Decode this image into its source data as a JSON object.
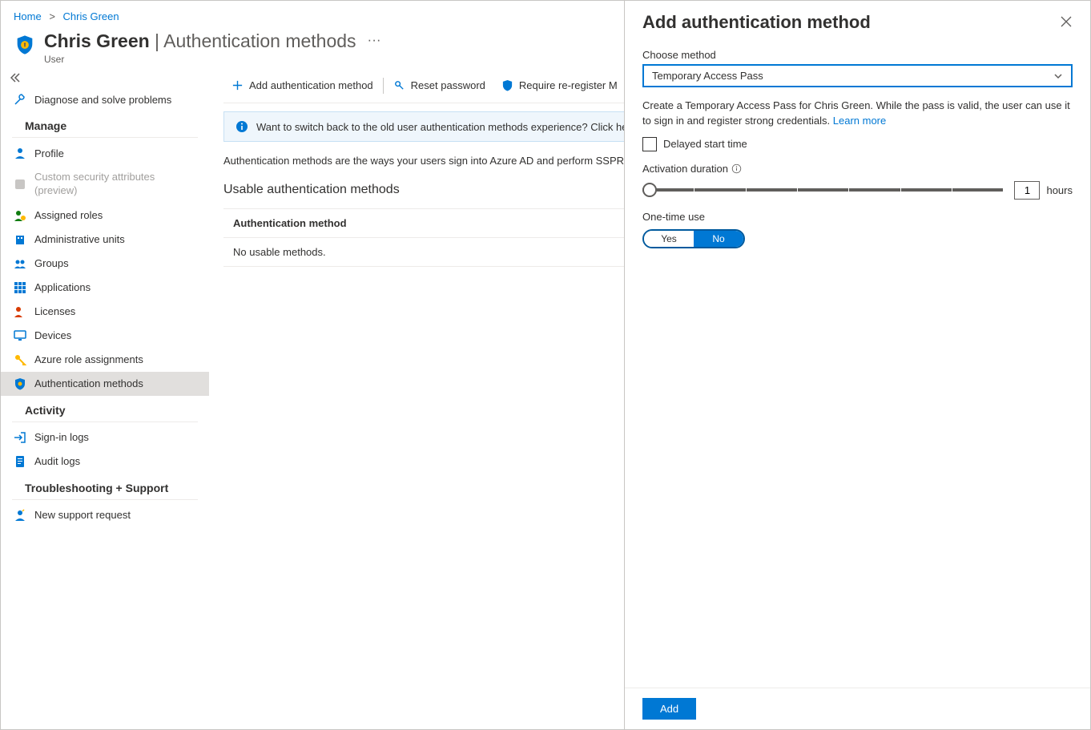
{
  "breadcrumb": {
    "home": "Home",
    "user": "Chris Green"
  },
  "header": {
    "title_main": "Chris Green",
    "title_sep": " | ",
    "title_page": "Authentication methods",
    "subtitle": "User"
  },
  "sidebar": {
    "diagnose": "Diagnose and solve problems",
    "section_manage": "Manage",
    "profile": "Profile",
    "custom_sec": "Custom security attributes (preview)",
    "assigned_roles": "Assigned roles",
    "admin_units": "Administrative units",
    "groups": "Groups",
    "applications": "Applications",
    "licenses": "Licenses",
    "devices": "Devices",
    "azure_role": "Azure role assignments",
    "auth_methods": "Authentication methods",
    "section_activity": "Activity",
    "signin_logs": "Sign-in logs",
    "audit_logs": "Audit logs",
    "section_trouble": "Troubleshooting + Support",
    "new_support": "New support request"
  },
  "commands": {
    "add": "Add authentication method",
    "reset": "Reset password",
    "require": "Require re-register M"
  },
  "banner": "Want to switch back to the old user authentication methods experience? Click here to",
  "body_text": "Authentication methods are the ways your users sign into Azure AD and perform SSPR.",
  "section_title": "Usable authentication methods",
  "table": {
    "col_method": "Authentication method",
    "no_methods": "No usable methods."
  },
  "panel": {
    "title": "Add authentication method",
    "choose_label": "Choose method",
    "selected": "Temporary Access Pass",
    "help_pre": "Create a Temporary Access Pass for Chris Green. While the pass is valid, the user can use it to sign in and register strong credentials. ",
    "learn_more": "Learn more",
    "delayed": "Delayed start time",
    "activation": "Activation duration",
    "duration_value": "1",
    "duration_unit": "hours",
    "onetime_label": "One-time use",
    "yes": "Yes",
    "no": "No",
    "add_btn": "Add"
  }
}
